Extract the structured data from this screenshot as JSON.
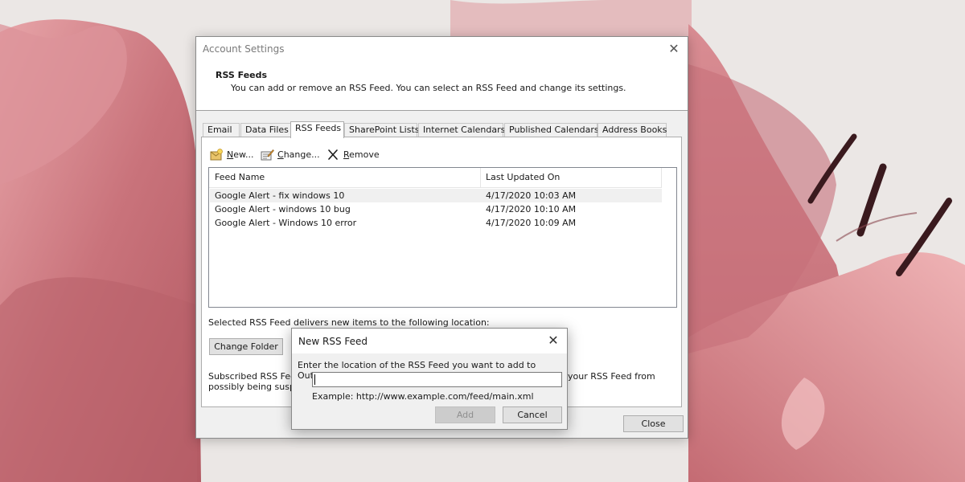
{
  "dialog": {
    "title": "Account Settings",
    "close_glyph": "✕",
    "header_title": "RSS Feeds",
    "header_desc": "You can add or remove an RSS Feed. You can select an RSS Feed and change its settings."
  },
  "tabs": [
    {
      "label": "Email"
    },
    {
      "label": "Data Files"
    },
    {
      "label": "RSS Feeds",
      "active": true
    },
    {
      "label": "SharePoint Lists"
    },
    {
      "label": "Internet Calendars"
    },
    {
      "label": "Published Calendars"
    },
    {
      "label": "Address Books"
    }
  ],
  "toolbar": {
    "new_label": "New...",
    "change_label": "Change...",
    "remove_label": "Remove"
  },
  "feeds": {
    "columns": [
      "Feed Name",
      "Last Updated On"
    ],
    "rows": [
      {
        "name": "Google Alert - fix windows 10",
        "updated": "4/17/2020 10:03 AM",
        "selected": true
      },
      {
        "name": "Google Alert - windows 10 bug",
        "updated": "4/17/2020 10:10 AM"
      },
      {
        "name": "Google Alert - Windows 10 error",
        "updated": "4/17/2020 10:09 AM"
      }
    ]
  },
  "location": {
    "label": "Selected RSS Feed delivers new items to the following location:",
    "change_folder_label": "Change Folder"
  },
  "subscribed": {
    "text_a": "Subscribed RSS Feed",
    "text_b": "possibly being susp",
    "text_c": "your RSS Feed from"
  },
  "close_label": "Close",
  "new_rss": {
    "title": "New RSS Feed",
    "close_glyph": "✕",
    "prompt": "Enter the location of the RSS Feed you want to add to Outlook:",
    "input_value": "",
    "example": "Example: http://www.example.com/feed/main.xml",
    "add_label": "Add",
    "cancel_label": "Cancel"
  },
  "colors": {
    "accent": "#0078d7",
    "petal": "#c66e77",
    "petal_light": "#e3a2a6",
    "stamen": "#3a1a1e"
  }
}
